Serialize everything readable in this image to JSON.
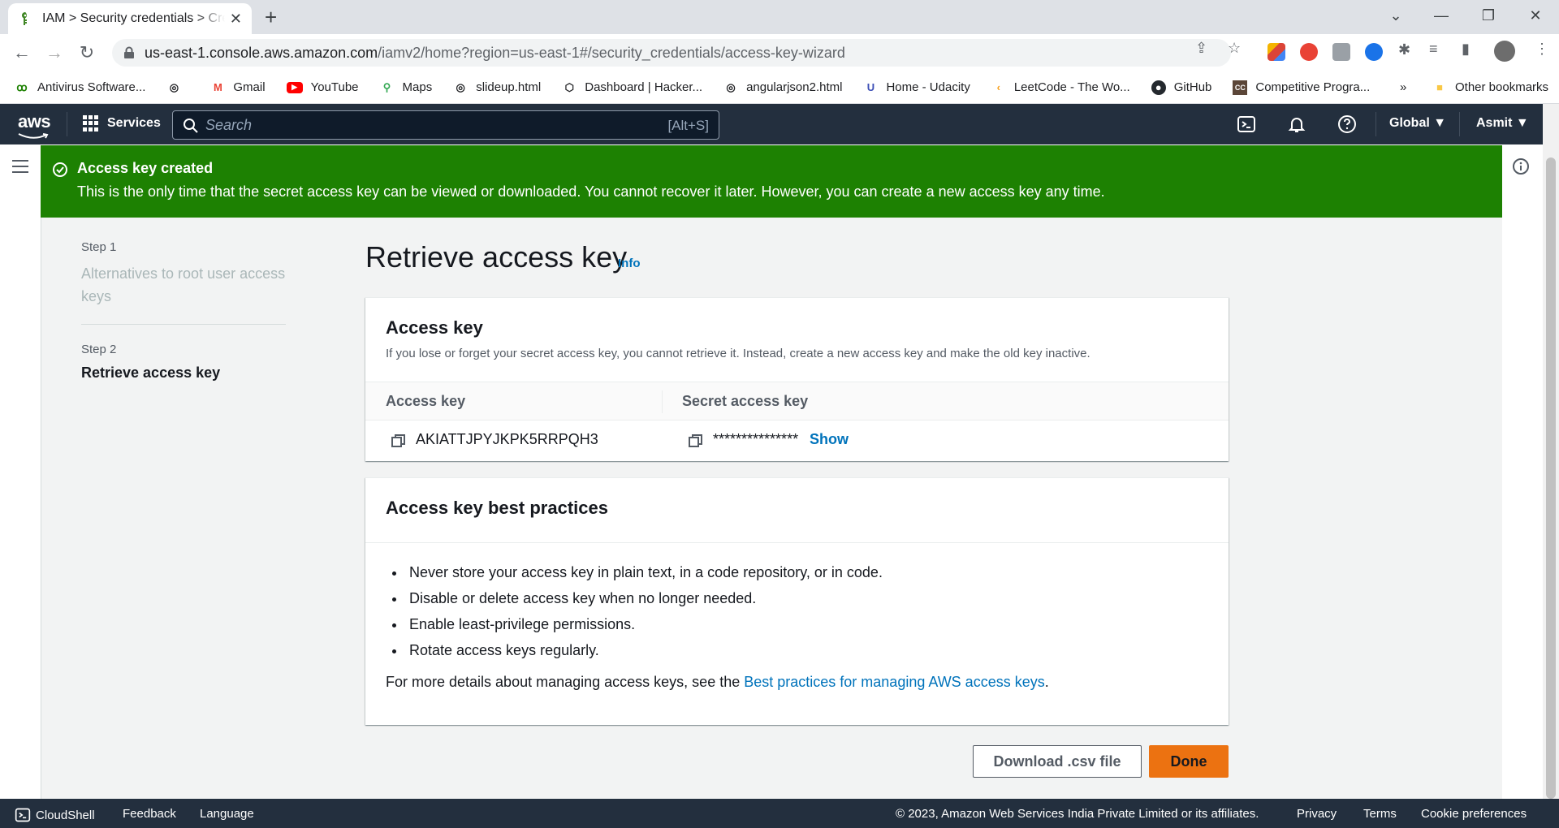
{
  "browser": {
    "tab_title": "IAM > Security credentials > Create access key",
    "new_tab": "+",
    "url_host": "us-east-1.console.aws.amazon.com",
    "url_rest": "/iamv2/home?region=us-east-1#/security_credentials/access-key-wizard",
    "bookmarks": [
      {
        "label": "Antivirus Software...",
        "icon": "antivirus-icon"
      },
      {
        "label": "",
        "icon": "globe-icon"
      },
      {
        "label": "Gmail",
        "icon": "gmail-icon"
      },
      {
        "label": "YouTube",
        "icon": "youtube-icon"
      },
      {
        "label": "Maps",
        "icon": "maps-icon"
      },
      {
        "label": "slideup.html",
        "icon": "globe-icon"
      },
      {
        "label": "Dashboard | Hacker...",
        "icon": "hackerrank-icon"
      },
      {
        "label": "angularjson2.html",
        "icon": "globe-icon"
      },
      {
        "label": "Home - Udacity",
        "icon": "udacity-icon"
      },
      {
        "label": "LeetCode - The Wo...",
        "icon": "leetcode-icon"
      },
      {
        "label": "GitHub",
        "icon": "github-icon"
      },
      {
        "label": "Competitive Progra...",
        "icon": "cc-icon"
      }
    ],
    "bookmarks_more": "»",
    "other_bookmarks": "Other bookmarks"
  },
  "aws_nav": {
    "logo": "aws",
    "services": "Services",
    "search_placeholder": "Search",
    "search_shortcut": "[Alt+S]",
    "region": "Global",
    "account": "Asmit"
  },
  "flash": {
    "title": "Access key created",
    "message": "This is the only time that the secret access key can be viewed or downloaded. You cannot recover it later. However, you can create a new access key any time."
  },
  "wizard": {
    "step1_label": "Step 1",
    "step1_title": "Alternatives to root user access keys",
    "step2_label": "Step 2",
    "step2_title": "Retrieve access key"
  },
  "page": {
    "title": "Retrieve access key",
    "info": "Info"
  },
  "access_key_card": {
    "title": "Access key",
    "description": "If you lose or forget your secret access key, you cannot retrieve it. Instead, create a new access key and make the old key inactive.",
    "col_access_key": "Access key",
    "col_secret_key": "Secret access key",
    "access_key_value": "AKIATTJPYJKPK5RRPQH3",
    "secret_key_masked": "***************",
    "show": "Show"
  },
  "best_practices": {
    "title": "Access key best practices",
    "items": [
      "Never store your access key in plain text, in a code repository, or in code.",
      "Disable or delete access key when no longer needed.",
      "Enable least-privilege permissions.",
      "Rotate access keys regularly."
    ],
    "more_prefix": "For more details about managing access keys, see the ",
    "more_link": "Best practices for managing AWS access keys",
    "more_suffix": "."
  },
  "actions": {
    "download": "Download .csv file",
    "done": "Done"
  },
  "footer": {
    "cloudshell": "CloudShell",
    "feedback": "Feedback",
    "language": "Language",
    "copyright": "© 2023, Amazon Web Services India Private Limited or its affiliates.",
    "privacy": "Privacy",
    "terms": "Terms",
    "cookies": "Cookie preferences"
  },
  "colors": {
    "aws_nav": "#232f3e",
    "flash_success": "#1d8102",
    "link": "#0073bb",
    "primary_button": "#ec7211"
  }
}
